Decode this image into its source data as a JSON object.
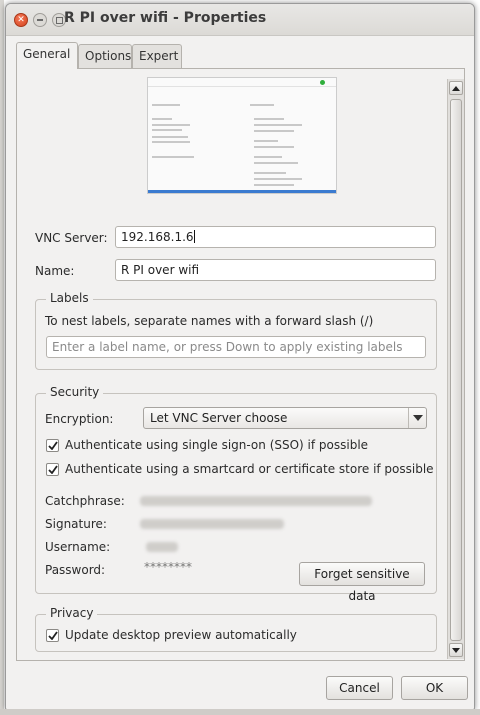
{
  "window": {
    "title": "R PI over wifi - Properties"
  },
  "tabs": [
    {
      "label": "General",
      "active": true
    },
    {
      "label": "Options",
      "active": false
    },
    {
      "label": "Expert",
      "active": false
    }
  ],
  "preview": {
    "alt": "desktop preview thumbnail"
  },
  "general": {
    "vnc_server_label": "VNC Server:",
    "vnc_server_value": "192.168.1.6",
    "name_label": "Name:",
    "name_value": "R PI over wifi"
  },
  "labels_section": {
    "title": "Labels",
    "hint": "To nest labels, separate names with a forward slash (/)",
    "placeholder": "Enter a label name, or press Down to apply existing labels"
  },
  "security": {
    "title": "Security",
    "encryption_label": "Encryption:",
    "encryption_value": "Let VNC Server choose",
    "sso_label": "Authenticate using single sign-on (SSO) if possible",
    "sso_checked": true,
    "smartcard_label": "Authenticate using a smartcard or certificate store if possible",
    "smartcard_checked": true,
    "catchphrase_label": "Catchphrase:",
    "signature_label": "Signature:",
    "username_label": "Username:",
    "password_label": "Password:",
    "password_value": "********",
    "forget_button": "Forget sensitive data"
  },
  "privacy": {
    "title": "Privacy",
    "update_preview_label": "Update desktop preview automatically",
    "update_preview_checked": true
  },
  "footer": {
    "cancel_label": "Cancel",
    "ok_label": "OK"
  },
  "colors": {
    "window_bg": "#f2f1f0",
    "close_button": "#e05a30"
  }
}
